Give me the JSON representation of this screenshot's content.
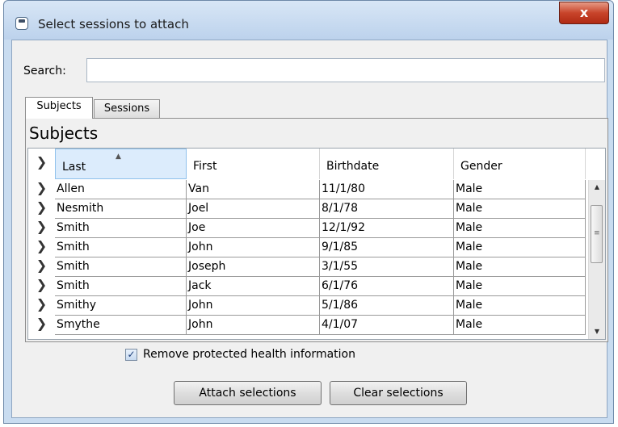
{
  "window": {
    "title": "Select sessions to attach",
    "close_label": "x"
  },
  "search": {
    "label": "Search:",
    "value": ""
  },
  "tabs": [
    {
      "label": "Subjects",
      "active": true
    },
    {
      "label": "Sessions",
      "active": false
    }
  ],
  "panel": {
    "title": "Subjects"
  },
  "table": {
    "columns": [
      "Last",
      "First",
      "Birthdate",
      "Gender"
    ],
    "sorted_column": "Last",
    "rows": [
      [
        "Allen",
        "Van",
        "11/1/80",
        "Male"
      ],
      [
        "Nesmith",
        "Joel",
        "8/1/78",
        "Male"
      ],
      [
        "Smith",
        "Joe",
        "12/1/92",
        "Male"
      ],
      [
        "Smith",
        "John",
        "9/1/85",
        "Male"
      ],
      [
        "Smith",
        "Joseph",
        "3/1/55",
        "Male"
      ],
      [
        "Smith",
        "Jack",
        "6/1/76",
        "Male"
      ],
      [
        "Smithy",
        "John",
        "5/1/86",
        "Male"
      ],
      [
        "Smythe",
        "John",
        "4/1/07",
        "Male"
      ]
    ]
  },
  "options": {
    "remove_phi_label": "Remove protected health information",
    "remove_phi_checked": true
  },
  "buttons": {
    "attach": "Attach selections",
    "clear": "Clear selections"
  },
  "icons": {
    "row_indicator": "chevron-right-icon",
    "sort": "sort-ascending-icon",
    "app": "window-icon"
  },
  "colors": {
    "title_bar": "#bcd2ec",
    "close_button": "#c8442a",
    "sorted_header": "#dcecfc"
  }
}
